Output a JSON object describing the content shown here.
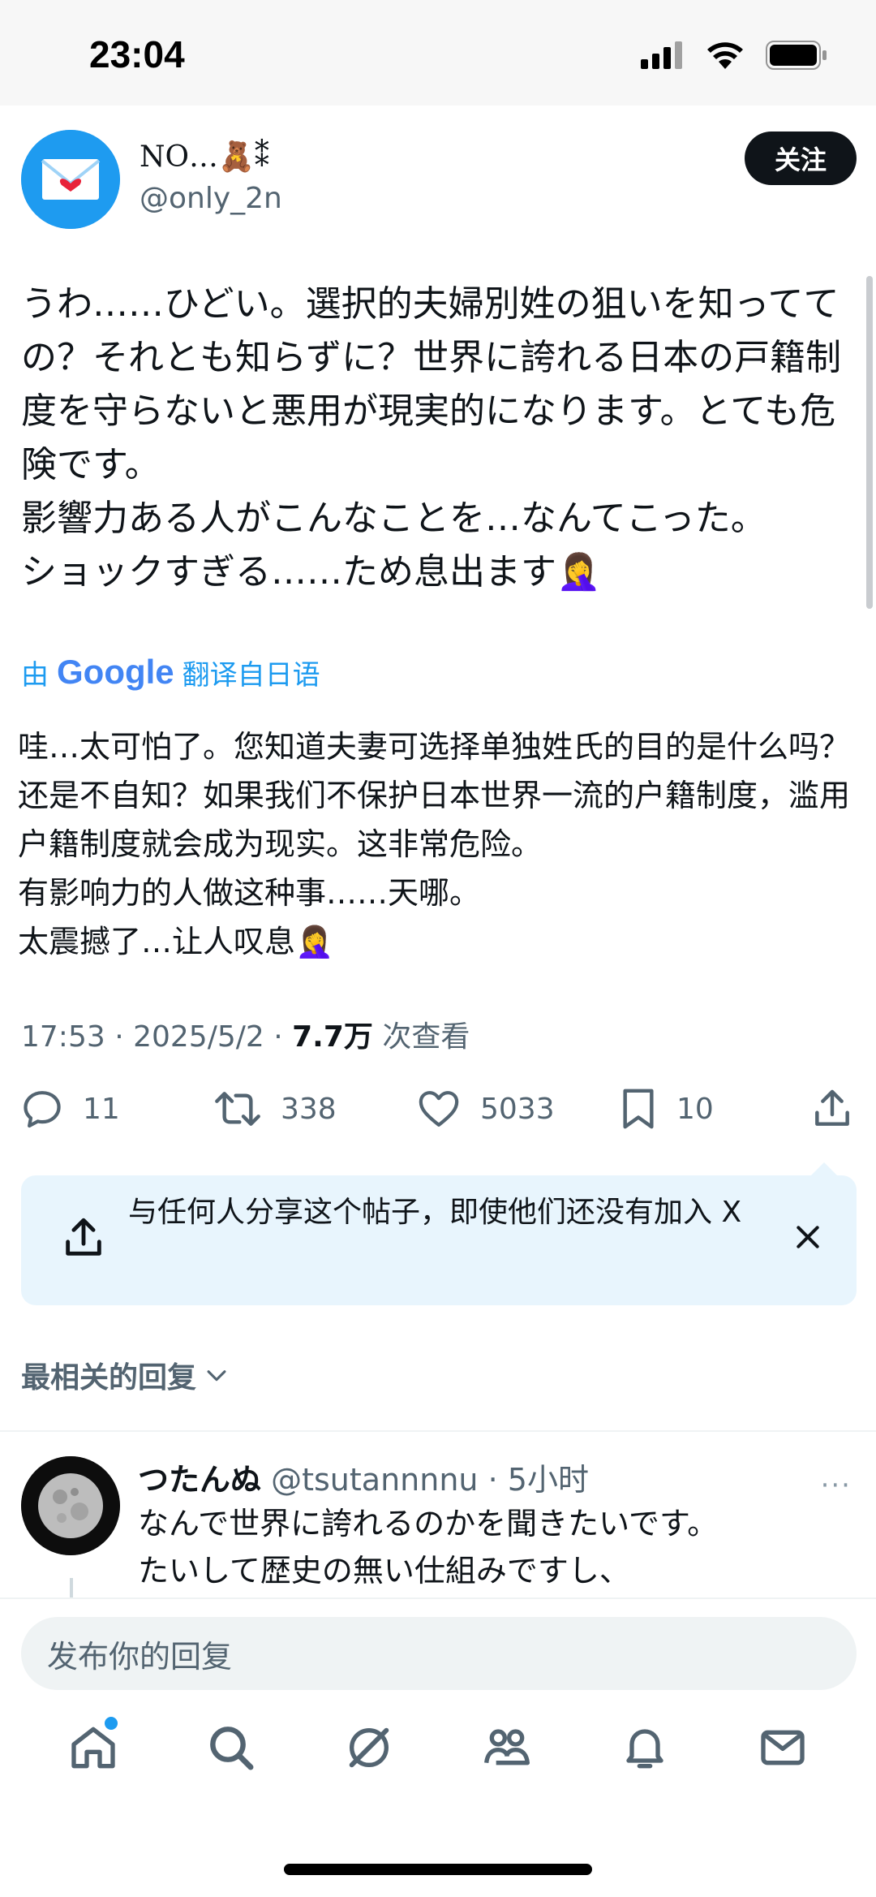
{
  "status_bar": {
    "time": "23:04"
  },
  "author": {
    "display_name": "NO…🧸⁑",
    "handle": "@only_2n",
    "follow_label": "关注"
  },
  "tweet": {
    "text": "うわ……ひどい。選択的夫婦別姓の狙いを知ってての？それとも知らずに？世界に誇れる日本の戸籍制度を守らないと悪用が現実的になります。とても危険です。\n影響力ある人がこんなことを…なんてこった。\nショックすぎる……ため息出ます🤦‍♀️",
    "translate_prefix": "由",
    "translate_brand": "Google",
    "translate_suffix": "翻译自日语",
    "translated_text": "哇…太可怕了。您知道夫妻可选择单独姓氏的目的是什么吗？还是不自知？如果我们不保护日本世界一流的户籍制度，滥用户籍制度就会成为现实。这非常危险。\n有影响力的人做这种事……天哪。\n太震撼了…让人叹息🤦‍♀️",
    "time": "17:53",
    "date": "2025/5/2",
    "views_count": "7.7万",
    "views_label": "次查看"
  },
  "actions": {
    "replies": "11",
    "retweets": "338",
    "likes": "5033",
    "bookmarks": "10"
  },
  "share_banner": {
    "text": "与任何人分享这个帖子，即使他们还没有加入 X"
  },
  "replies_sort": {
    "label": "最相关的回复"
  },
  "reply": {
    "name": "つたんぬ",
    "handle": "@tsutannnnu",
    "time": "5小时",
    "more": "···",
    "text": "なんで世界に誇れるのかを聞きたいです。\nたいして歴史の無い仕組みですし、"
  },
  "reply_bar": {
    "placeholder": "发布你的回复"
  },
  "colors": {
    "accent": "#1d9bf0",
    "text": "#0f1419",
    "muted": "#536471",
    "banner_bg": "#e8f5fd"
  },
  "icons": {
    "nav": [
      "home-icon",
      "search-icon",
      "grok-icon",
      "communities-icon",
      "notifications-icon",
      "messages-icon"
    ]
  }
}
